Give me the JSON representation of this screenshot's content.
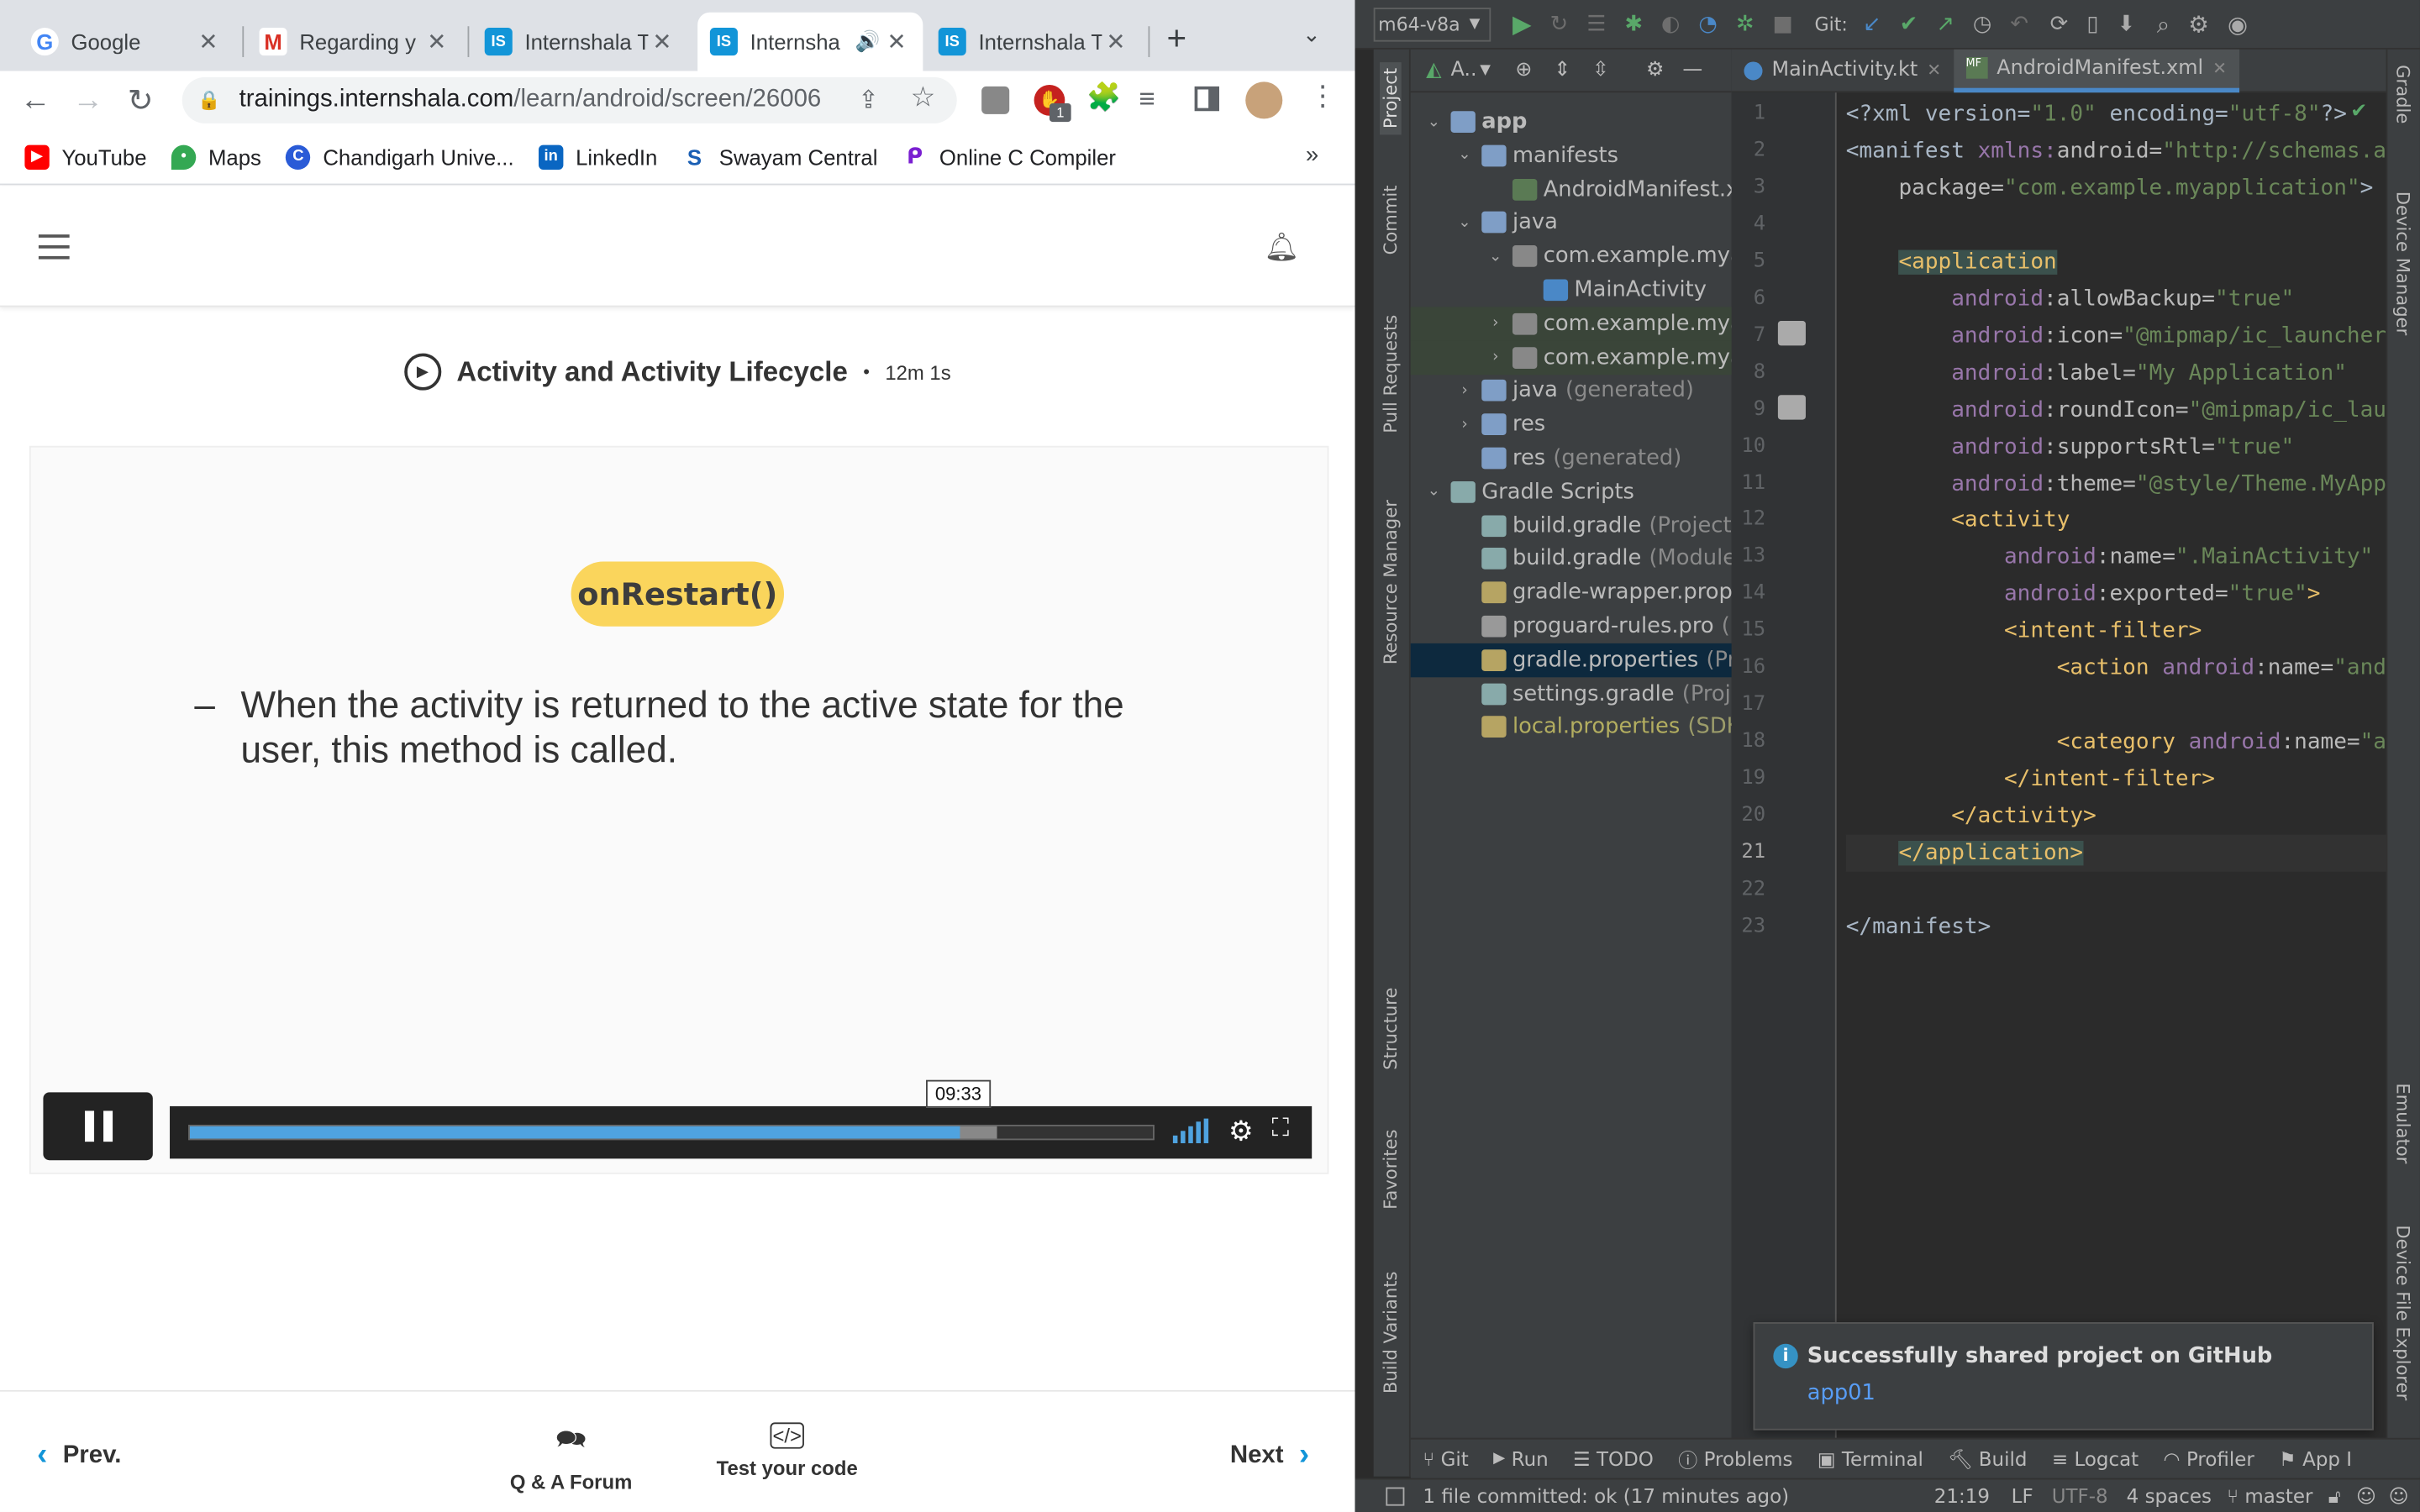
{
  "browser": {
    "tabs": [
      {
        "title": "Google",
        "favicon": "google-icon"
      },
      {
        "title": "Regarding y",
        "favicon": "gmail-icon"
      },
      {
        "title": "Internshala T",
        "favicon": "internshala-icon"
      },
      {
        "title": "Internsha",
        "favicon": "internshala-icon",
        "active": true
      },
      {
        "title": "Internshala T",
        "favicon": "internshala-icon"
      }
    ],
    "url_host": "trainings.internshala.com",
    "url_path": "/learn/android/screen/26006",
    "extension_badge": "1",
    "bookmarks": [
      "YouTube",
      "Maps",
      "Chandigarh Unive...",
      "LinkedIn",
      "Swayam Central",
      "Online C Compiler"
    ],
    "bookmarks_overflow": "»"
  },
  "lesson": {
    "title": "Activity and Activity Lifecycle",
    "separator": "•",
    "duration": "12m 1s",
    "slide_method": "onRestart()",
    "slide_bullet": "–",
    "slide_text": "When the activity is returned to the active state for the user, this method is called.",
    "player": {
      "tooltip_time": "09:33",
      "played_fraction": 0.797,
      "buffered_fraction": 0.835
    }
  },
  "footer_nav": {
    "prev": "Prev.",
    "qa": "Q & A Forum",
    "test": "Test your code",
    "next": "Next"
  },
  "studio": {
    "device": "m64-v8a",
    "git_label": "Git:",
    "project_header": "A..",
    "left_tools": [
      "Project",
      "Commit",
      "Pull Requests",
      "Resource Manager",
      "Structure",
      "Favorites",
      "Build Variants"
    ],
    "right_tools": [
      "Gradle",
      "Device Manager",
      "Emulator",
      "Device File Explorer"
    ],
    "tree": [
      {
        "label": "app",
        "indent": 0,
        "arrow": "open",
        "icon": "folder",
        "bold": true
      },
      {
        "label": "manifests",
        "indent": 1,
        "arrow": "open",
        "icon": "folder"
      },
      {
        "label": "AndroidManifest.x",
        "indent": 2,
        "arrow": "",
        "icon": "manifest"
      },
      {
        "label": "java",
        "indent": 1,
        "arrow": "open",
        "icon": "folder"
      },
      {
        "label": "com.example.mya",
        "indent": 2,
        "arrow": "open",
        "icon": "package"
      },
      {
        "label": "MainActivity",
        "indent": 3,
        "arrow": "",
        "icon": "kotlin"
      },
      {
        "label": "com.example.mya",
        "indent": 2,
        "arrow": "closed",
        "icon": "package",
        "hl": true
      },
      {
        "label": "com.example.mya",
        "indent": 2,
        "arrow": "closed",
        "icon": "package",
        "hl": true
      },
      {
        "label": "java",
        "suffix": "(generated)",
        "indent": 1,
        "arrow": "closed",
        "icon": "folder"
      },
      {
        "label": "res",
        "indent": 1,
        "arrow": "closed",
        "icon": "folder"
      },
      {
        "label": "res",
        "suffix": "(generated)",
        "indent": 1,
        "arrow": "",
        "icon": "folder"
      },
      {
        "label": "Gradle Scripts",
        "indent": 0,
        "arrow": "open",
        "icon": "gradle"
      },
      {
        "label": "build.gradle",
        "suffix": "(Project:",
        "indent": 1,
        "arrow": "",
        "icon": "gradle"
      },
      {
        "label": "build.gradle",
        "suffix": "(Module",
        "indent": 1,
        "arrow": "",
        "icon": "gradle"
      },
      {
        "label": "gradle-wrapper.prop",
        "indent": 1,
        "arrow": "",
        "icon": "props"
      },
      {
        "label": "proguard-rules.pro",
        "suffix": "(I",
        "indent": 1,
        "arrow": "",
        "icon": "file"
      },
      {
        "label": "gradle.properties",
        "suffix": "(Pr",
        "indent": 1,
        "arrow": "",
        "icon": "props",
        "sel": true
      },
      {
        "label": "settings.gradle",
        "suffix": "(Proj",
        "indent": 1,
        "arrow": "",
        "icon": "gradle"
      },
      {
        "label": "local.properties",
        "suffix": "(SDK",
        "indent": 1,
        "arrow": "",
        "icon": "props",
        "yellow": true
      }
    ],
    "editor_tabs": [
      "MainActivity.kt",
      "AndroidManifest.xml"
    ],
    "code_lines": [
      [
        [
          "syn-plain",
          "<?xml version="
        ],
        [
          "syn-str",
          "\"1.0\""
        ],
        [
          "syn-plain",
          " encoding="
        ],
        [
          "syn-str",
          "\"utf-8\""
        ],
        [
          "syn-plain",
          "?>"
        ]
      ],
      [
        [
          "syn-plain",
          "<manifest "
        ],
        [
          "syn-attrns",
          "xmlns:"
        ],
        [
          "syn-attr",
          "android="
        ],
        [
          "syn-str",
          "\"http://schemas.a"
        ]
      ],
      [
        [
          "syn-plain",
          "    "
        ],
        [
          "syn-attr",
          "package="
        ],
        [
          "syn-str",
          "\"com.example.myapplication\""
        ],
        [
          "syn-plain",
          ">"
        ]
      ],
      [],
      [
        [
          "syn-plain",
          "    "
        ],
        [
          "syn-tag",
          "<application"
        ]
      ],
      [
        [
          "syn-plain",
          "        "
        ],
        [
          "syn-attrns",
          "android"
        ],
        [
          "syn-attr",
          ":allowBackup="
        ],
        [
          "syn-str",
          "\"true\""
        ]
      ],
      [
        [
          "syn-plain",
          "        "
        ],
        [
          "syn-attrns",
          "android"
        ],
        [
          "syn-attr",
          ":icon="
        ],
        [
          "syn-str",
          "\"@mipmap/ic_launcher"
        ]
      ],
      [
        [
          "syn-plain",
          "        "
        ],
        [
          "syn-attrns",
          "android"
        ],
        [
          "syn-attr",
          ":label="
        ],
        [
          "syn-str",
          "\"My Application\""
        ]
      ],
      [
        [
          "syn-plain",
          "        "
        ],
        [
          "syn-attrns",
          "android"
        ],
        [
          "syn-attr",
          ":roundIcon="
        ],
        [
          "syn-str",
          "\"@mipmap/ic_lau"
        ]
      ],
      [
        [
          "syn-plain",
          "        "
        ],
        [
          "syn-attrns",
          "android"
        ],
        [
          "syn-attr",
          ":supportsRtl="
        ],
        [
          "syn-str",
          "\"true\""
        ]
      ],
      [
        [
          "syn-plain",
          "        "
        ],
        [
          "syn-attrns",
          "android"
        ],
        [
          "syn-attr",
          ":theme="
        ],
        [
          "syn-str",
          "\"@style/Theme.MyApp"
        ]
      ],
      [
        [
          "syn-plain",
          "        "
        ],
        [
          "syn-tag",
          "<activity"
        ]
      ],
      [
        [
          "syn-plain",
          "            "
        ],
        [
          "syn-attrns",
          "android"
        ],
        [
          "syn-attr",
          ":name="
        ],
        [
          "syn-str",
          "\".MainActivity\""
        ]
      ],
      [
        [
          "syn-plain",
          "            "
        ],
        [
          "syn-attrns",
          "android"
        ],
        [
          "syn-attr",
          ":exported="
        ],
        [
          "syn-str",
          "\"true\""
        ],
        [
          "syn-tag",
          ">"
        ]
      ],
      [
        [
          "syn-plain",
          "            "
        ],
        [
          "syn-tag",
          "<intent-filter>"
        ]
      ],
      [
        [
          "syn-plain",
          "                "
        ],
        [
          "syn-tag",
          "<action "
        ],
        [
          "syn-attrns",
          "android"
        ],
        [
          "syn-attr",
          ":name="
        ],
        [
          "syn-str",
          "\"and"
        ]
      ],
      [],
      [
        [
          "syn-plain",
          "                "
        ],
        [
          "syn-tag",
          "<category "
        ],
        [
          "syn-attrns",
          "android"
        ],
        [
          "syn-attr",
          ":name="
        ],
        [
          "syn-str",
          "\"a"
        ]
      ],
      [
        [
          "syn-plain",
          "            "
        ],
        [
          "syn-tag",
          "</intent-filter>"
        ]
      ],
      [
        [
          "syn-plain",
          "        "
        ],
        [
          "syn-tag",
          "</activity>"
        ]
      ],
      [
        [
          "syn-plain",
          "    "
        ],
        [
          "syn-tag",
          "</application>"
        ]
      ],
      [],
      [
        [
          "syn-plain",
          "</manifest>"
        ]
      ]
    ],
    "current_line": 21,
    "notification": {
      "title": "Successfully shared project on GitHub",
      "link": "app01"
    },
    "bottom_tools": [
      "Git",
      "Run",
      "TODO",
      "Problems",
      "Terminal",
      "Build",
      "Logcat",
      "Profiler",
      "App I"
    ],
    "status": {
      "message": "1 file committed: ok (17 minutes ago)",
      "position": "21:19",
      "line_sep": "LF",
      "encoding": "UTF-8",
      "indent": "4 spaces",
      "branch": "master"
    }
  }
}
